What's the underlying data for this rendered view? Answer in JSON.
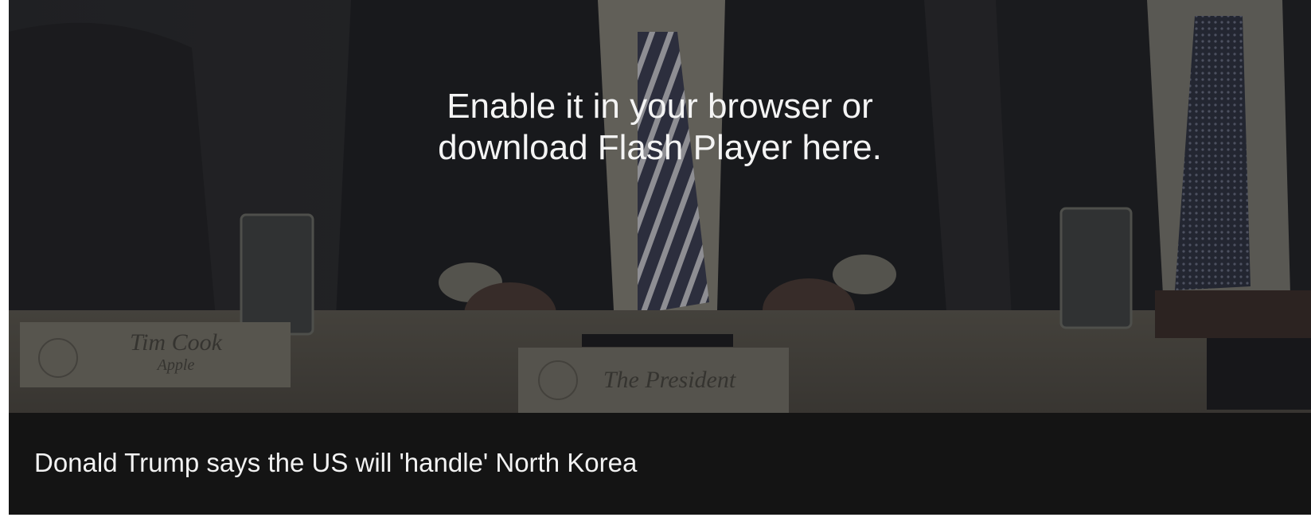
{
  "player": {
    "flash_message_line1": "Enable it in your browser or",
    "flash_message_line2": "download Flash Player here.",
    "caption": "Donald Trump says the US will 'handle' North Korea"
  },
  "video_frame": {
    "nameplate_left_name": "Tim Cook",
    "nameplate_left_org": "Apple",
    "nameplate_center": "The President"
  },
  "colors": {
    "player_background": "#141414",
    "caption_text": "#f2f2f2",
    "message_text": "#f4f4f4"
  }
}
